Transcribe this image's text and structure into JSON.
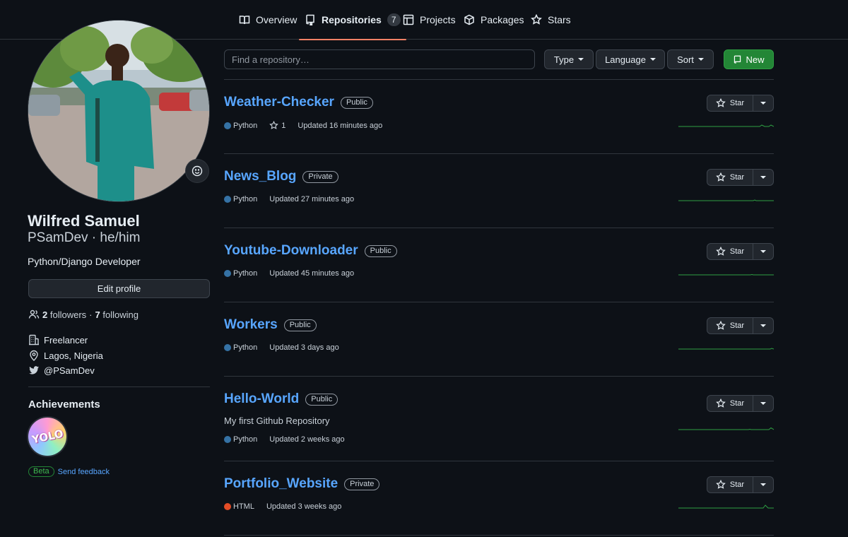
{
  "tabs": [
    {
      "label": "Overview",
      "icon": "book-icon"
    },
    {
      "label": "Repositories",
      "count": "7",
      "icon": "repo-icon",
      "active": true
    },
    {
      "label": "Projects",
      "icon": "table-icon"
    },
    {
      "label": "Packages",
      "icon": "package-icon"
    },
    {
      "label": "Stars",
      "icon": "star-icon"
    }
  ],
  "profile": {
    "name": "Wilfred Samuel",
    "handle": "PSamDev · he/him",
    "bio": "Python/Django Developer",
    "edit_label": "Edit profile",
    "followers_count": "2",
    "followers_label": "followers",
    "separator": "·",
    "following_count": "7",
    "following_label": "following",
    "company": "Freelancer",
    "location": "Lagos, Nigeria",
    "twitter": "@PSamDev"
  },
  "achievements": {
    "title": "Achievements",
    "badge_text": "YOLO",
    "beta_label": "Beta",
    "feedback_label": "Send feedback"
  },
  "filters": {
    "search_placeholder": "Find a repository…",
    "type_label": "Type",
    "language_label": "Language",
    "sort_label": "Sort",
    "new_label": "New"
  },
  "star_label": "Star",
  "repos": [
    {
      "name": "Weather-Checker",
      "visibility": "Public",
      "description": "",
      "language": "Python",
      "lang_color": "#3572A5",
      "stars": "1",
      "updated": "Updated 16 minutes ago"
    },
    {
      "name": "News_Blog",
      "visibility": "Private",
      "description": "",
      "language": "Python",
      "lang_color": "#3572A5",
      "stars": "",
      "updated": "Updated 27 minutes ago"
    },
    {
      "name": "Youtube-Downloader",
      "visibility": "Public",
      "description": "",
      "language": "Python",
      "lang_color": "#3572A5",
      "stars": "",
      "updated": "Updated 45 minutes ago"
    },
    {
      "name": "Workers",
      "visibility": "Public",
      "description": "",
      "language": "Python",
      "lang_color": "#3572A5",
      "stars": "",
      "updated": "Updated 3 days ago"
    },
    {
      "name": "Hello-World",
      "visibility": "Public",
      "description": "My first Github Repository",
      "language": "Python",
      "lang_color": "#3572A5",
      "stars": "",
      "updated": "Updated 2 weeks ago"
    },
    {
      "name": "Portfolio_Website",
      "visibility": "Private",
      "description": "",
      "language": "HTML",
      "lang_color": "#e34c26",
      "stars": "",
      "updated": "Updated 3 weeks ago"
    }
  ],
  "colors": {
    "accent": "#58a6ff",
    "tab_underline": "#f78166",
    "new_button": "#238636",
    "spark": "#2ea043"
  }
}
